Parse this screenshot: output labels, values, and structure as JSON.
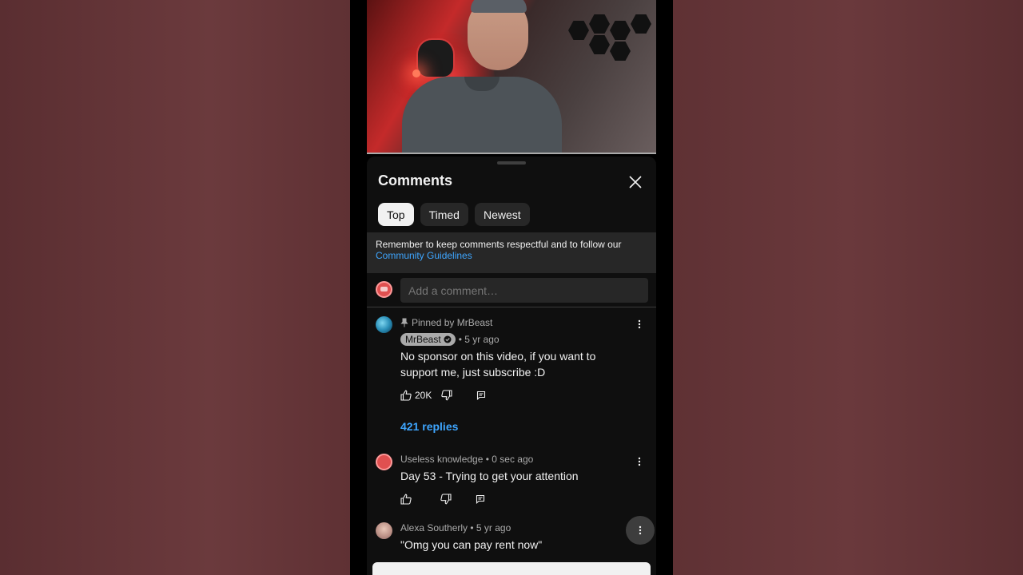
{
  "sheet": {
    "title": "Comments",
    "chips": [
      "Top",
      "Timed",
      "Newest"
    ],
    "notice_text": "Remember to keep comments respectful and to follow our",
    "notice_link": "Community Guidelines",
    "input_placeholder": "Add a comment…"
  },
  "comments": [
    {
      "pinned_label": "Pinned by MrBeast",
      "author": "MrBeast",
      "time": "• 5 yr ago",
      "text": "No sponsor on this video, if you want to support me, just subscribe :D",
      "likes": "20K",
      "replies": "421 replies"
    },
    {
      "author_meta": "Useless knowledge • 0 sec ago",
      "text": "Day 53 - Trying to get your attention"
    },
    {
      "author_meta": "Alexa Southerly • 5 yr ago",
      "text": "\"Omg you can pay rent now\""
    }
  ],
  "colors": {
    "background": "#0f0f0f",
    "chip": "#272727",
    "link": "#3ea6ff",
    "text": "#f1f1f1",
    "secondary": "#aaaaaa"
  },
  "icons": [
    "close-icon",
    "pin-icon",
    "verified-icon",
    "like-icon",
    "dislike-icon",
    "reply-icon",
    "more-vert-icon"
  ]
}
